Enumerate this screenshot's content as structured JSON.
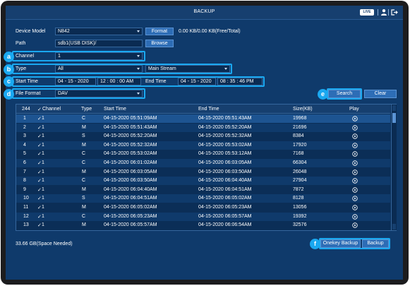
{
  "window": {
    "title": "BACKUP",
    "live_label": "LIVE"
  },
  "device": {
    "label": "Device Model",
    "value": "N842",
    "format_button": "Format",
    "capacity": "0.00 KB/0.00 KB(Free/Total)"
  },
  "path": {
    "label": "Path",
    "value": "sdb1(USB DISK)/",
    "browse_button": "Browse"
  },
  "channel": {
    "label": "Channel",
    "value": "1"
  },
  "type": {
    "label": "Type",
    "value": "All",
    "stream": "Main Stream"
  },
  "time": {
    "start_label": "Start Time",
    "start_date": "04 - 15 - 2020",
    "start_time": "12 : 00 : 00 AM",
    "end_label": "End Time",
    "end_date": "04 - 15 - 2020",
    "end_time": "08 : 35 : 46 PM"
  },
  "file_format": {
    "label": "File Format",
    "value": "DAV"
  },
  "buttons": {
    "search": "Search",
    "clear": "Clear",
    "onekey_backup": "Onekey Backup",
    "backup": "Backup"
  },
  "callouts": [
    "a",
    "b",
    "c",
    "d",
    "e",
    "f"
  ],
  "table": {
    "count": "244",
    "check_mark": "✓",
    "headers": {
      "channel": "Channel",
      "type": "Type",
      "start": "Start Time",
      "end": "End Time",
      "size": "Size(KB)",
      "play": "Play"
    },
    "rows": [
      {
        "num": "1",
        "channel": "1",
        "type": "C",
        "start": "04-15-2020 05:51:09AM",
        "end": "04-15-2020 05:51:43AM",
        "size": "19968"
      },
      {
        "num": "2",
        "channel": "1",
        "type": "M",
        "start": "04-15-2020 05:51:43AM",
        "end": "04-15-2020 05:52:20AM",
        "size": "21696"
      },
      {
        "num": "3",
        "channel": "1",
        "type": "S",
        "start": "04-15-2020 05:52:20AM",
        "end": "04-15-2020 05:52:32AM",
        "size": "8384"
      },
      {
        "num": "4",
        "channel": "1",
        "type": "M",
        "start": "04-15-2020 05:52:32AM",
        "end": "04-15-2020 05:53:02AM",
        "size": "17920"
      },
      {
        "num": "5",
        "channel": "1",
        "type": "C",
        "start": "04-15-2020 05:53:02AM",
        "end": "04-15-2020 05:53:12AM",
        "size": "7168"
      },
      {
        "num": "6",
        "channel": "1",
        "type": "C",
        "start": "04-15-2020 06:01:02AM",
        "end": "04-15-2020 06:03:05AM",
        "size": "66304"
      },
      {
        "num": "7",
        "channel": "1",
        "type": "M",
        "start": "04-15-2020 06:03:05AM",
        "end": "04-15-2020 06:03:50AM",
        "size": "26048"
      },
      {
        "num": "8",
        "channel": "1",
        "type": "C",
        "start": "04-15-2020 06:03:50AM",
        "end": "04-15-2020 06:04:40AM",
        "size": "27904"
      },
      {
        "num": "9",
        "channel": "1",
        "type": "M",
        "start": "04-15-2020 06:04:40AM",
        "end": "04-15-2020 06:04:51AM",
        "size": "7872"
      },
      {
        "num": "10",
        "channel": "1",
        "type": "S",
        "start": "04-15-2020 06:04:51AM",
        "end": "04-15-2020 06:05:02AM",
        "size": "8128"
      },
      {
        "num": "11",
        "channel": "1",
        "type": "M",
        "start": "04-15-2020 06:05:02AM",
        "end": "04-15-2020 06:05:23AM",
        "size": "13056"
      },
      {
        "num": "12",
        "channel": "1",
        "type": "C",
        "start": "04-15-2020 06:05:23AM",
        "end": "04-15-2020 06:05:57AM",
        "size": "19392"
      },
      {
        "num": "13",
        "channel": "1",
        "type": "M",
        "start": "04-15-2020 06:05:57AM",
        "end": "04-15-2020 06:06:54AM",
        "size": "32576"
      }
    ]
  },
  "space_needed": "33.66 GB(Space Needed)"
}
